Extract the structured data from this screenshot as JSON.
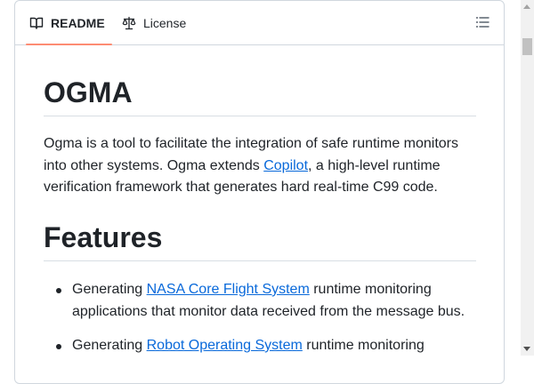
{
  "tabs": {
    "readme_label": "README",
    "license_label": "License"
  },
  "icons": {
    "readme": "book-icon",
    "license": "law-scale-icon",
    "toc": "list-unordered-icon"
  },
  "colors": {
    "link": "#0969da",
    "active_tab_underline": "#fd8c73",
    "border": "#d0d7de"
  },
  "readme": {
    "title": "OGMA",
    "intro_before_link": "Ogma is a tool to facilitate the integration of safe runtime monitors into other systems. Ogma extends ",
    "intro_link": "Copilot",
    "intro_after_link": ", a high-level runtime verification framework that generates hard real-time C99 code.",
    "features_heading": "Features",
    "features": [
      {
        "before": "Generating ",
        "link": "NASA Core Flight System",
        "after": " runtime monitoring applications that monitor data received from the message bus."
      },
      {
        "before": "Generating ",
        "link": "Robot Operating System",
        "after": " runtime monitoring"
      }
    ]
  }
}
